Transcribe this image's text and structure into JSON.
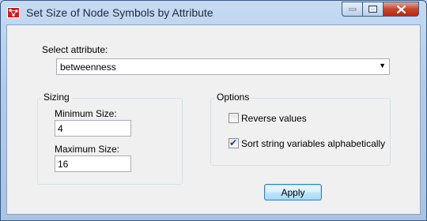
{
  "window": {
    "title": "Set Size of Node Symbols by Attribute"
  },
  "attribute": {
    "label": "Select attribute:",
    "selected": "betweenness"
  },
  "sizing": {
    "title": "Sizing",
    "min_label": "Minimum Size:",
    "min_value": "4",
    "max_label": "Maximum Size:",
    "max_value": "16"
  },
  "options": {
    "title": "Options",
    "reverse_label": "Reverse values",
    "reverse_checked": false,
    "sort_label": "Sort string variables alphabetically",
    "sort_checked": true
  },
  "buttons": {
    "apply": "Apply"
  }
}
